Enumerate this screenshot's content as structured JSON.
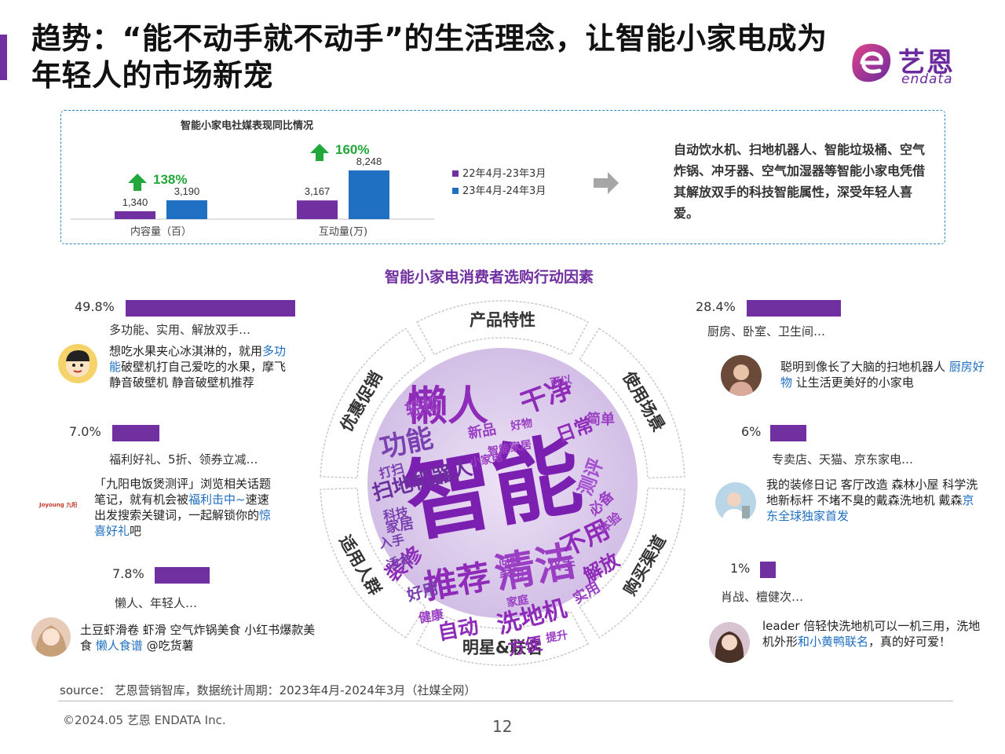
{
  "header": {
    "title": "趋势：“能不动手就不动手”的生活理念，让智能小家电成为年轻人的市场新宠",
    "logo_cn": "艺恩",
    "logo_en": "endata"
  },
  "stats": {
    "description": "自动饮水机、扫地机器人、智能垃圾桶、空气炸锅、冲牙器、空气加湿器等智能小家电凭借其解放双手的科技智能属性，深受年轻人喜爱。"
  },
  "chart_data": {
    "type": "bar",
    "title": "智能小家电社媒表现同比情况",
    "categories": [
      "内容量（百）",
      "互动量(万)"
    ],
    "series": [
      {
        "name": "22年4月-23年3月",
        "values": [
          1340,
          3167
        ],
        "labels": [
          "1,340",
          "3,167"
        ],
        "color": "#7030a0"
      },
      {
        "name": "23年4月-24年3月",
        "values": [
          3190,
          8248
        ],
        "labels": [
          "3,190",
          "8,248"
        ],
        "color": "#1f6fc2"
      }
    ],
    "growth": [
      "138%",
      "160%"
    ],
    "growth_color": "#22a83a"
  },
  "wordcloud": {
    "title": "智能小家电消费者选购行动因素",
    "segments": [
      "产品特性",
      "使用场景",
      "购买渠道",
      "明星&联名",
      "适用人群",
      "优惠促销"
    ],
    "words": [
      "智能",
      "懒人",
      "清洁",
      "推荐",
      "功能",
      "干净",
      "扫地机器人",
      "自动",
      "洗地机",
      "不用",
      "测评",
      "日常",
      "简单",
      "轻松",
      "方便",
      "好用",
      "装修",
      "家居",
      "家庭",
      "新品",
      "家用",
      "解放",
      "双手",
      "必备",
      "实用",
      "科技",
      "入手",
      "适合",
      "问题",
      "体验",
      "健康",
      "提升",
      "可以",
      "好物",
      "小家电",
      "打扫",
      "智能家居"
    ]
  },
  "factors": {
    "product": {
      "pct": "49.8%",
      "value": 49.8,
      "keywords": "多功能、实用、解放双手…",
      "quote_parts": [
        "想吃水果夹心冰淇淋的，就用",
        "多功能",
        "破壁机打自己爱吃的水果，摩飞静音破壁机 静音破壁机推荐"
      ]
    },
    "promo": {
      "pct": "7.0%",
      "value": 7.0,
      "keywords": "福利好礼、5折、领券立减…",
      "brand": "Joyoung 九阳",
      "quote_parts": [
        "「九阳电饭煲测评」浏览相关话题笔记，就有机会被",
        "福利击中~",
        "速速出发搜索关键词，一起解锁你的",
        "惊喜好礼",
        "吧"
      ]
    },
    "people": {
      "pct": "7.8%",
      "value": 7.8,
      "keywords": "懒人、年轻人…",
      "quote_parts": [
        "土豆虾滑卷 虾滑 空气炸锅美食 小红书爆款美食 ",
        "懒人食谱",
        " @吃货薯"
      ]
    },
    "scene": {
      "pct": "28.4%",
      "value": 28.4,
      "keywords": "厨房、卧室、卫生间…",
      "quote_parts": [
        "聪明到像长了大脑的扫地机器人 ",
        "厨房好物",
        " 让生活更美好的小家电"
      ]
    },
    "channel": {
      "pct": "6%",
      "value": 6,
      "keywords": "专卖店、天猫、京东家电…",
      "quote_parts": [
        "我的装修日记 客厅改造 森林小屋 科学洗地新标杆 不堵不臭的戴森洗地机 戴森",
        "京东全球独家首发"
      ]
    },
    "celebrity": {
      "pct": "1%",
      "value": 1,
      "keywords": "肖战、檀健次…",
      "quote_parts": [
        "leader 倍轻快洗地机可以一机三用，洗地机外形",
        "和小黄鸭联名",
        "，真的好可爱！"
      ]
    }
  },
  "footer": {
    "source": "source： 艺恩营销智库，数据统计周期：2023年4月-2024年3月（社媒全网）",
    "copyright": "©2024.05 艺恩 ENDATA Inc.",
    "page": "12"
  }
}
